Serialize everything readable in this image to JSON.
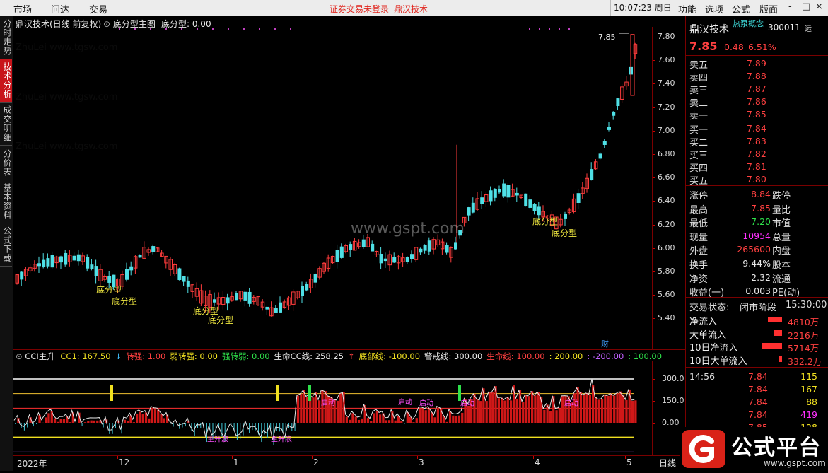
{
  "topbar": {
    "menu": [
      "市场",
      "问达",
      "交易"
    ],
    "warning": "证券交易未登录",
    "warning_brand": "鼎汉技术",
    "clock": "10:07:23",
    "weekday": "周日",
    "right_menu": [
      "功能",
      "选项",
      "公式",
      "版面"
    ],
    "win_buttons": [
      "-",
      "□",
      "×"
    ]
  },
  "side_tabs": [
    {
      "label": "分时走势",
      "active": false
    },
    {
      "label": "技术分析",
      "active": true
    },
    {
      "label": "成交明细",
      "active": false
    },
    {
      "label": "分价表",
      "active": false
    },
    {
      "label": "基本资料",
      "active": false
    },
    {
      "label": "公式下载",
      "active": false
    }
  ],
  "main_chart": {
    "stock_title": "鼎汉技术(日线 前复权)",
    "indicator_title": "底分型主图",
    "indicator_value": "底分型: 0.00",
    "price_ticks": [
      "7.80",
      "7.60",
      "7.40",
      "7.20",
      "7.00",
      "6.80",
      "6.60",
      "6.40",
      "6.20",
      "6.00",
      "5.80",
      "5.60",
      "5.40"
    ],
    "last_price_label": "7.85",
    "pattern_label": "底分型",
    "finance_marker": "财",
    "watermark": "www.gspt.com",
    "bg_watermark": "ZhuLei www.tgsw.com"
  },
  "sub_chart": {
    "name": "CCI主升",
    "items": [
      {
        "text": "CC1: 167.50",
        "color": "#f0e020"
      },
      {
        "text": "↓",
        "color": "#40c0ff"
      },
      {
        "text": "转强: 1.00",
        "color": "#ff4040"
      },
      {
        "text": "弱转强: 0.00",
        "color": "#f0e020"
      },
      {
        "text": "强转弱: 0.00",
        "color": "#2ee04a"
      },
      {
        "text": "生命CC线: 258.25",
        "color": "#e8e8e8"
      },
      {
        "text": "↑",
        "color": "#ff4040"
      },
      {
        "text": "底部线: -100.00",
        "color": "#f0e020"
      },
      {
        "text": "警戒线: 300.00",
        "color": "#e8e8e8"
      },
      {
        "text": "生命线: 100.00",
        "color": "#ff4040"
      },
      {
        "text": ": 200.00",
        "color": "#f0e020"
      },
      {
        "text": ": -200.00",
        "color": "#c060ff"
      },
      {
        "text": ": 100.00",
        "color": "#2ee04a"
      }
    ],
    "ticks": [
      "300.0",
      "150.0",
      "0.00"
    ],
    "labels": [
      "主升浪",
      "主升浪",
      "启动",
      "启动",
      "启动",
      "启动",
      "启动"
    ]
  },
  "date_axis": {
    "labels": [
      "2022年",
      "12",
      "1",
      "2",
      "3",
      "4",
      "5"
    ],
    "period": "日线"
  },
  "quote": {
    "name": "鼎汉技术",
    "concept": "热泵概念",
    "code": "300011",
    "price": "7.85",
    "change": "0.48",
    "change_pct": "6.51%",
    "sells": [
      {
        "label": "卖五",
        "price": "7.89"
      },
      {
        "label": "卖四",
        "price": "7.88"
      },
      {
        "label": "卖三",
        "price": "7.87"
      },
      {
        "label": "卖二",
        "price": "7.86"
      },
      {
        "label": "卖一",
        "price": "7.85"
      }
    ],
    "buys": [
      {
        "label": "买一",
        "price": "7.84"
      },
      {
        "label": "买二",
        "price": "7.83"
      },
      {
        "label": "买三",
        "price": "7.82"
      },
      {
        "label": "买四",
        "price": "7.81"
      },
      {
        "label": "买五",
        "price": "7.80"
      }
    ],
    "stats": [
      {
        "l1": "涨停",
        "v1": "8.84",
        "c1": "red",
        "l2": "跌停"
      },
      {
        "l1": "最高",
        "v1": "7.85",
        "c1": "red",
        "l2": "量比"
      },
      {
        "l1": "最低",
        "v1": "7.20",
        "c1": "green",
        "l2": "市值"
      },
      {
        "l1": "现量",
        "v1": "10954",
        "c1": "magenta",
        "l2": "总量"
      },
      {
        "l1": "外盘",
        "v1": "265600",
        "c1": "red",
        "l2": "内盘"
      },
      {
        "l1": "换手",
        "v1": "9.44%",
        "c1": "white",
        "l2": "股本"
      },
      {
        "l1": "净资",
        "v1": "2.32",
        "c1": "white",
        "l2": "流通"
      },
      {
        "l1": "收益(一)",
        "v1": "0.003",
        "c1": "white",
        "l2": "PE(动)"
      }
    ],
    "status_label": "交易状态:",
    "status": "闭市阶段",
    "status_time": "15:30:00",
    "flows": [
      {
        "label": "净流入",
        "value": "4810万",
        "bar": 0.55
      },
      {
        "label": "大单流入",
        "value": "2216万",
        "bar": 0.3
      },
      {
        "label": "10日净流入",
        "value": "5714万",
        "bar": 0.8
      },
      {
        "label": "10日大单流入",
        "value": "332.2万",
        "bar": 0.15
      }
    ],
    "ticks_time": "14:56",
    "trades": [
      {
        "price": "7.84",
        "vol": "115",
        "color": "yellow"
      },
      {
        "price": "7.84",
        "vol": "167",
        "color": "yellow"
      },
      {
        "price": "7.84",
        "vol": "88",
        "color": "yellow"
      },
      {
        "price": "7.84",
        "vol": "419",
        "color": "magenta"
      },
      {
        "price": "7.85",
        "vol": "128",
        "color": "yellow"
      }
    ]
  },
  "logo": {
    "text": "公式平台",
    "url": "www.gspt.com"
  }
}
